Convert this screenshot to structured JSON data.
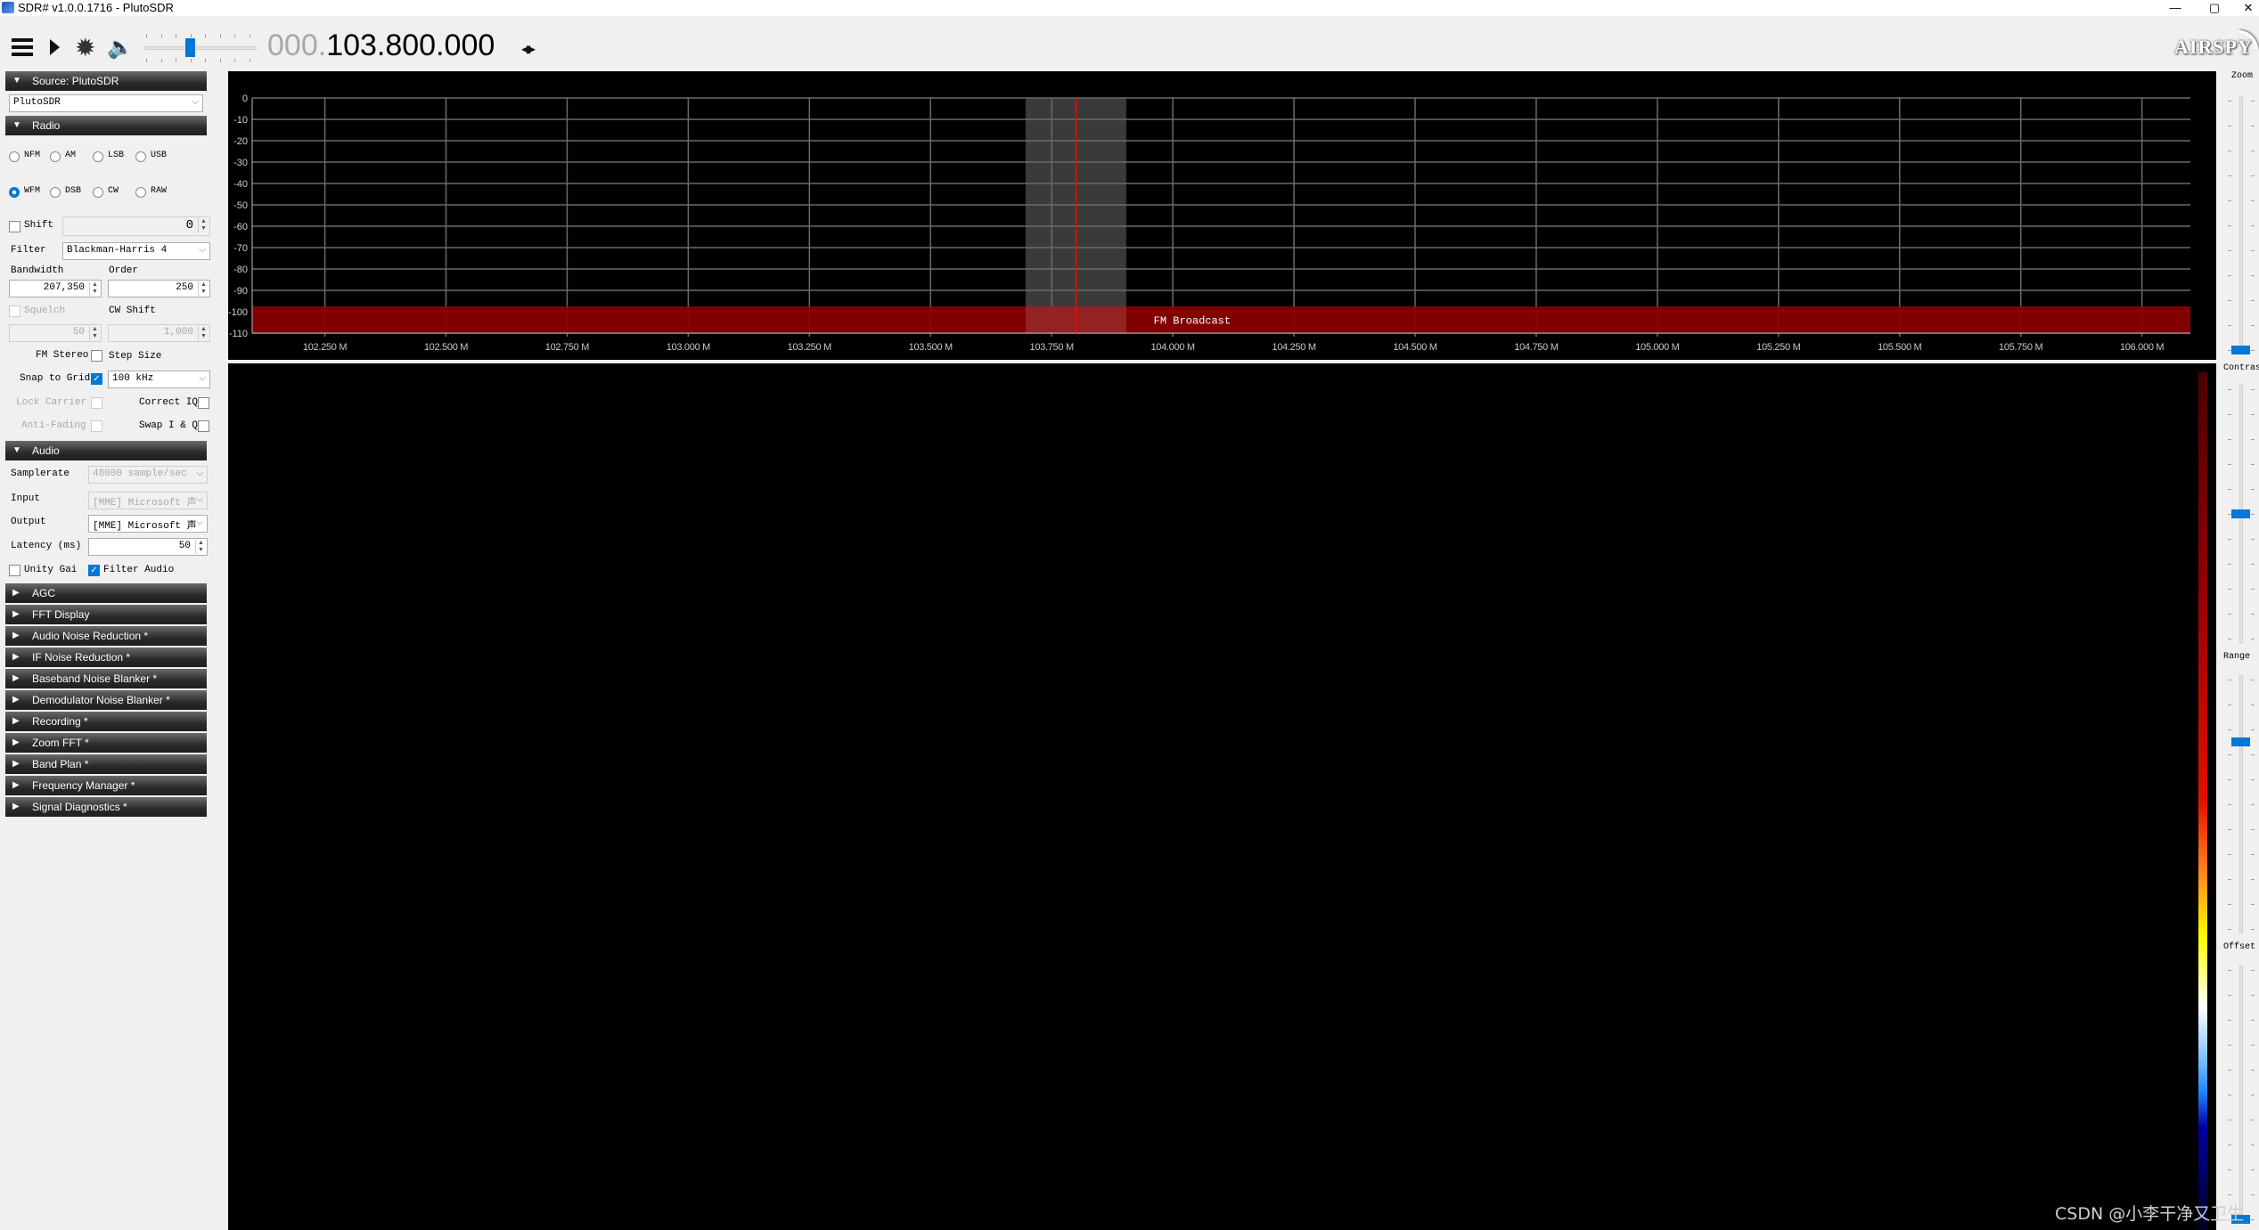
{
  "window": {
    "title": "SDR# v1.0.0.1716 - PlutoSDR",
    "controls": {
      "minimize": "—",
      "maximize": "▢",
      "close": "✕"
    }
  },
  "toolbar": {
    "icons": [
      "menu-icon",
      "play-icon",
      "gear-icon",
      "speaker-icon"
    ],
    "volume_fraction": 0.4,
    "frequency_prefix": "000.",
    "frequency_main": "103.800.000",
    "tune_arrows": "◂▸",
    "brand": "AIRSPY"
  },
  "left_panel": {
    "source": {
      "header": "Source: PlutoSDR",
      "device": "PlutoSDR"
    },
    "radio": {
      "header": "Radio",
      "modes": [
        {
          "label": "NFM",
          "selected": false
        },
        {
          "label": "AM",
          "selected": false
        },
        {
          "label": "LSB",
          "selected": false
        },
        {
          "label": "USB",
          "selected": false
        },
        {
          "label": "WFM",
          "selected": true
        },
        {
          "label": "DSB",
          "selected": false
        },
        {
          "label": "CW",
          "selected": false
        },
        {
          "label": "RAW",
          "selected": false
        }
      ],
      "shift_label": "Shift",
      "shift_value": "0",
      "filter_label": "Filter",
      "filter_value": "Blackman-Harris 4",
      "bandwidth_label": "Bandwidth",
      "bandwidth_value": "207,350",
      "order_label": "Order",
      "order_value": "250",
      "squelch_label": "Squelch",
      "squelch_value": "50",
      "cw_shift_label": "CW Shift",
      "cw_shift_value": "1,000",
      "fm_stereo_label": "FM Stereo",
      "step_size_label": "Step Size",
      "snap_to_grid_label": "Snap to Grid",
      "step_size_value": "100 kHz",
      "lock_carrier_label": "Lock Carrier",
      "correct_iq_label": "Correct IQ",
      "anti_fading_label": "Anti-Fading",
      "swap_iq_label": "Swap I & Q"
    },
    "audio": {
      "header": "Audio",
      "samplerate_label": "Samplerate",
      "samplerate_value": "48000 sample/sec",
      "input_label": "Input",
      "input_value": "[MME] Microsoft 声",
      "output_label": "Output",
      "output_value": "[MME] Microsoft 声",
      "latency_label": "Latency (ms)",
      "latency_value": "50",
      "unity_gain_label": "Unity Gai",
      "filter_audio_label": "Filter Audio"
    },
    "collapsed_sections": [
      "AGC",
      "FFT Display",
      "Audio Noise Reduction *",
      "IF Noise Reduction *",
      "Baseband Noise Blanker *",
      "Demodulator Noise Blanker *",
      "Recording *",
      "Zoom FFT *",
      "Band Plan *",
      "Frequency Manager *",
      "Signal Diagnostics *"
    ]
  },
  "chart_data": {
    "type": "line",
    "title": "",
    "xlabel": "",
    "ylabel": "",
    "x_ticks": [
      "102.250 M",
      "102.500 M",
      "102.750 M",
      "103.000 M",
      "103.250 M",
      "103.500 M",
      "103.750 M",
      "104.000 M",
      "104.250 M",
      "104.500 M",
      "104.750 M",
      "105.000 M",
      "105.250 M",
      "105.500 M",
      "105.750 M",
      "106.000 M"
    ],
    "x_tick_values_mhz": [
      102.25,
      102.5,
      102.75,
      103.0,
      103.25,
      103.5,
      103.75,
      104.0,
      104.25,
      104.5,
      104.75,
      105.0,
      105.25,
      105.5,
      105.75,
      106.0
    ],
    "xlim_mhz": [
      102.1,
      106.1
    ],
    "y_ticks": [
      "0",
      "-10",
      "-20",
      "-30",
      "-40",
      "-50",
      "-60",
      "-70",
      "-80",
      "-90",
      "-100",
      "-110"
    ],
    "ylim": [
      -110,
      0
    ],
    "grid": true,
    "center_frequency_mhz": 103.8,
    "filter_band_mhz": [
      103.696,
      103.904
    ],
    "band_plan": {
      "label": "FM Broadcast",
      "level_range_db": [
        -97.5,
        -110
      ],
      "color": "#8b0000"
    },
    "series": []
  },
  "right_sliders": [
    {
      "label": "Zoom",
      "value_fraction": 0.0
    },
    {
      "label": "Contras",
      "value_fraction": 0.5
    },
    {
      "label": "Range",
      "value_fraction": 0.75
    },
    {
      "label": "Offset",
      "value_fraction": 0.0
    }
  ],
  "watermark": "CSDN @小李干净又卫生",
  "colors": {
    "accent": "#0078d7",
    "band_plan_red": "#8b0000",
    "center_line": "#ff0000",
    "filter_band": "#3a3a3a"
  }
}
